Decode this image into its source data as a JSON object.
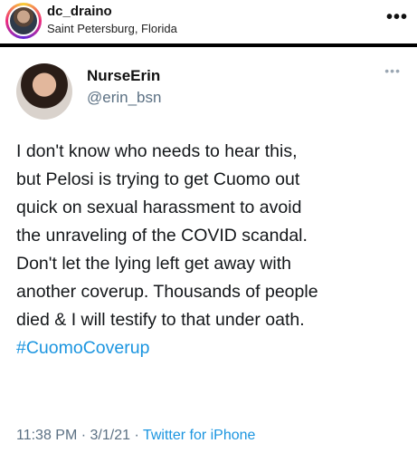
{
  "post": {
    "username": "dc_draino",
    "location": "Saint Petersburg, Florida",
    "more_icon": "•••"
  },
  "tweet": {
    "display_name": "NurseErin",
    "handle": "@erin_bsn",
    "more_icon": "•••",
    "text": "I don't know who needs to hear this,\nbut Pelosi is trying to get Cuomo out\nquick on sexual harassment to avoid\nthe unraveling of the COVID scandal.\nDon't let the lying left get away with\nanother coverup. Thousands of people\ndied & I will testify to that under oath.",
    "hashtag": "#CuomoCoverup",
    "time": "11:38 PM",
    "separator": " · ",
    "date": "3/1/21",
    "source": "Twitter for iPhone"
  }
}
